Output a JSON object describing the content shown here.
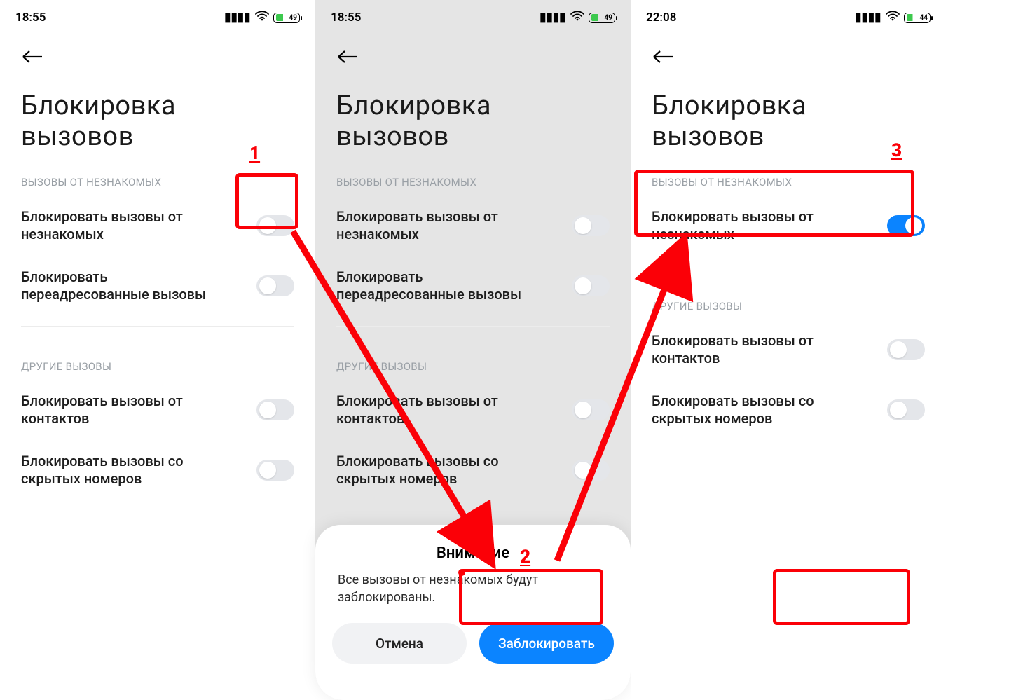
{
  "annotations": {
    "n1": "1",
    "n2": "2",
    "n3": "3"
  },
  "common": {
    "title_l1": "Блокировка",
    "title_l2": "вызовов",
    "section_strangers": "ВЫЗОВЫ ОТ НЕЗНАКОМЫХ",
    "section_other": "ДРУГИЕ ВЫЗОВЫ",
    "row_strangers": "Блокировать вызовы от незнакомых",
    "row_forwarded": "Блокировать переадресованные вызовы",
    "row_contacts": "Блокировать вызовы от контактов",
    "row_hidden": "Блокировать вызовы со скрытых номеров"
  },
  "dialog": {
    "title": "Внимание",
    "body": "Все вызовы от незнакомых будут заблокированы.",
    "cancel": "Отмена",
    "confirm": "Заблокировать"
  },
  "status": {
    "p1_time": "18:55",
    "p1_bat": "49",
    "p2_time": "18:55",
    "p2_bat": "49",
    "p3_time": "22:08",
    "p3_bat": "44"
  }
}
